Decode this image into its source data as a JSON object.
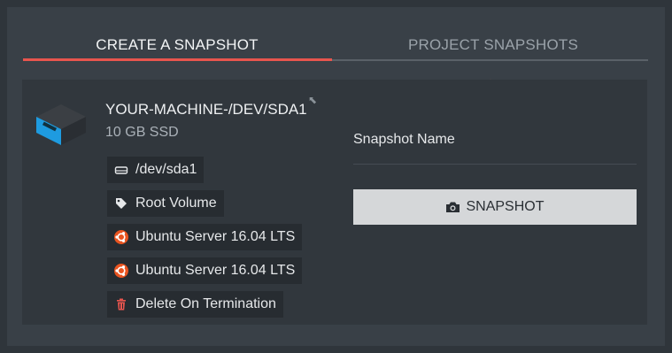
{
  "tabs": {
    "create": "CREATE A SNAPSHOT",
    "project": "PROJECT SNAPSHOTS"
  },
  "colors": {
    "accent": "#e8554e",
    "ubuntu": "#e95420"
  },
  "machine": {
    "name": "YOUR-MACHINE-/DEV/SDA1",
    "size": "10 GB SSD"
  },
  "chips": [
    {
      "icon": "hard-drive-icon",
      "text": "/dev/sda1"
    },
    {
      "icon": "tag-icon",
      "text": "Root Volume"
    },
    {
      "icon": "ubuntu-icon",
      "text": "Ubuntu Server 16.04 LTS"
    },
    {
      "icon": "ubuntu-icon",
      "text": "Ubuntu Server 16.04 LTS"
    },
    {
      "icon": "trash-icon",
      "text": "Delete On Termination"
    }
  ],
  "form": {
    "snapshot_name_label": "Snapshot Name",
    "snapshot_button": "SNAPSHOT"
  }
}
